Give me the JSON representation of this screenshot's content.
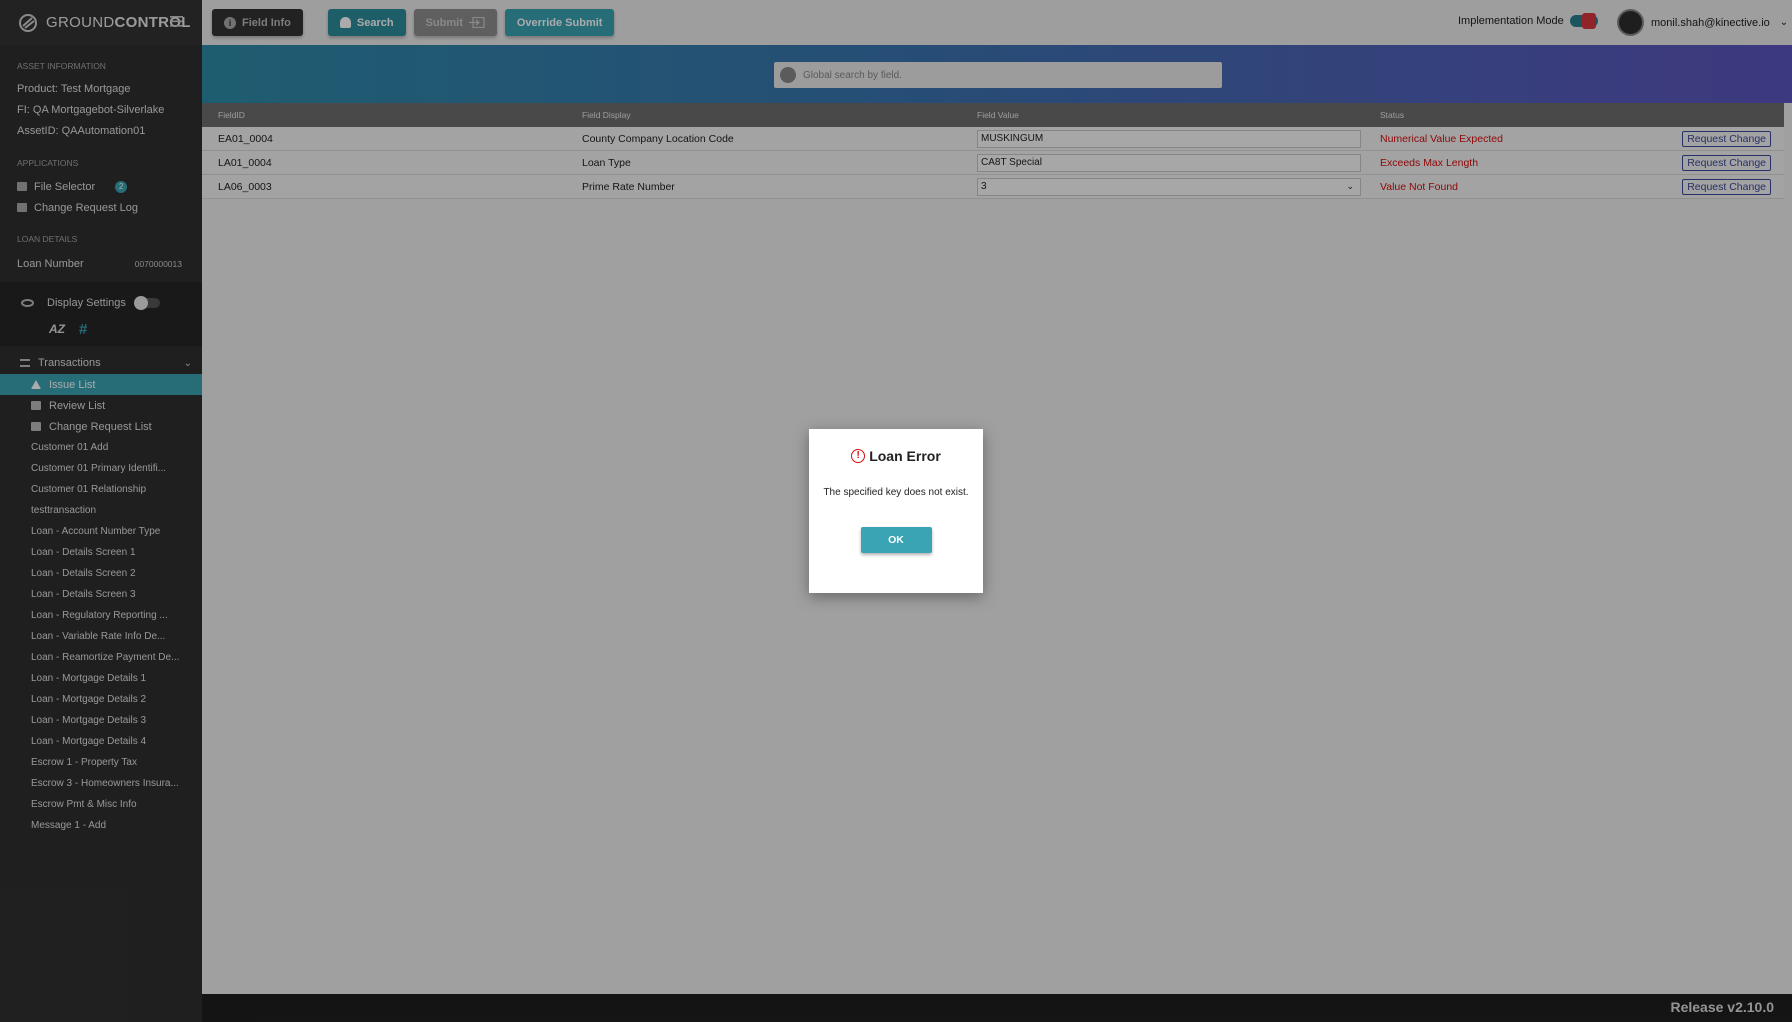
{
  "app": {
    "logo_ground": "GROUND",
    "logo_control": "CONTROL"
  },
  "toolbar": {
    "field_info": "Field Info",
    "search": "Search",
    "submit": "Submit",
    "override_submit": "Override Submit",
    "implementation_mode": "Implementation Mode",
    "user_email": "monil.shah@kinective.io"
  },
  "sidebar": {
    "asset_title": "ASSET INFORMATION",
    "product": "Product:  Test Mortgage",
    "fi": "FI:  QA Mortgagebot-Silverlake",
    "asset_id": "AssetID:  QAAutomation01",
    "applications_title": "APPLICATIONS",
    "file_selector": "File Selector",
    "file_selector_badge": "2",
    "change_request_log": "Change Request Log",
    "loan_details_title": "LOAN DETAILS",
    "loan_number_label": "Loan Number",
    "loan_number_value": "0070000013",
    "display_settings": "Display Settings",
    "sort_az": "AZ",
    "sort_hash": "#",
    "transactions": "Transactions",
    "nav": [
      {
        "label": "Issue List"
      },
      {
        "label": "Review List"
      },
      {
        "label": "Change Request List"
      }
    ],
    "transaction_items": [
      "Customer 01 Add",
      "Customer 01 Primary Identifi...",
      "Customer 01 Relationship",
      "testtransaction",
      "Loan - Account Number Type",
      "Loan - Details Screen 1",
      "Loan - Details Screen 2",
      "Loan - Details Screen 3",
      "Loan - Regulatory Reporting ...",
      "Loan - Variable Rate Info De...",
      "Loan - Reamortize Payment De...",
      "Loan - Mortgage Details 1",
      "Loan - Mortgage Details 2",
      "Loan - Mortgage Details 3",
      "Loan - Mortgage Details 4",
      "Escrow 1 - Property Tax",
      "Escrow 3 - Homeowners Insura...",
      "Escrow Pmt & Misc Info",
      "Message 1 - Add"
    ]
  },
  "search": {
    "placeholder": "Global search by field."
  },
  "table": {
    "headers": [
      "FieldID",
      "Field Display",
      "Field Value",
      "Status"
    ],
    "rows": [
      {
        "field_id": "EA01_0004",
        "field_display": "County Company Location Code",
        "field_value": "MUSKINGUM",
        "status": "Numerical Value Expected",
        "action": "Request Change"
      },
      {
        "field_id": "LA01_0004",
        "field_display": "Loan Type",
        "field_value": "CA8T Special",
        "status": "Exceeds Max Length",
        "action": "Request Change"
      },
      {
        "field_id": "LA06_0003",
        "field_display": "Prime Rate Number",
        "field_value": "3",
        "status": "Value Not Found",
        "action": "Request Change"
      }
    ]
  },
  "modal": {
    "title": "Loan Error",
    "message": "The specified key does not exist.",
    "ok": "OK"
  },
  "footer": {
    "release": "Release v2.10.0"
  },
  "colors": {
    "accent": "#3aa3b4",
    "error": "#d40f0f",
    "sidebar": "#2f2f2f"
  }
}
